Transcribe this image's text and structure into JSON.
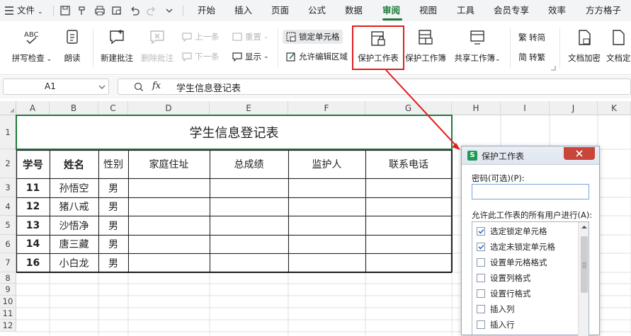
{
  "menubar": {
    "file_label": "文件",
    "tabs": [
      "开始",
      "插入",
      "页面",
      "公式",
      "数据",
      "审阅",
      "视图",
      "工具",
      "会员专享",
      "效率",
      "方方格子"
    ]
  },
  "ribbon": {
    "spellcheck": "拼写检查",
    "read_aloud": "朗读",
    "new_comment": "新建批注",
    "delete_comment": "删除批注",
    "prev_comment": "上一条",
    "next_comment": "下一条",
    "reset": "重置",
    "show": "显示",
    "lock_cell": "锁定单元格",
    "allow_edit_range": "允许编辑区域",
    "protect_sheet": "保护工作表",
    "protect_workbook": "保护工作簿",
    "share_workbook": "共享工作簿",
    "to_simplified": "转简",
    "to_traditional": "转繁",
    "doc_encrypt": "文档加密",
    "doc_final": "文档定"
  },
  "formula_bar": {
    "cell_ref": "A1",
    "fx": "fx",
    "content": "学生信息登记表"
  },
  "sheet": {
    "columns": [
      "A",
      "B",
      "C",
      "D",
      "E",
      "F",
      "G",
      "H",
      "I",
      "J",
      "K"
    ],
    "rows": [
      "1",
      "2",
      "3",
      "4",
      "5",
      "6",
      "7",
      "8",
      "9",
      "10",
      "11",
      "12"
    ],
    "title": "学生信息登记表",
    "headers": [
      "学号",
      "姓名",
      "性别",
      "家庭住址",
      "总成绩",
      "监护人",
      "联系电话"
    ],
    "data": [
      [
        "11",
        "孙悟空",
        "男"
      ],
      [
        "12",
        "猪八戒",
        "男"
      ],
      [
        "13",
        "沙悟净",
        "男"
      ],
      [
        "14",
        "唐三藏",
        "男"
      ],
      [
        "16",
        "小白龙",
        "男"
      ]
    ]
  },
  "dialog": {
    "app_badge": "S",
    "title": "保护工作表",
    "password_label": "密码(可选)(P):",
    "password_value": "",
    "allow_label": "允许此工作表的所有用户进行(A):",
    "options": [
      {
        "label": "选定锁定单元格",
        "checked": true
      },
      {
        "label": "选定未锁定单元格",
        "checked": true
      },
      {
        "label": "设置单元格格式",
        "checked": false
      },
      {
        "label": "设置列格式",
        "checked": false
      },
      {
        "label": "设置行格式",
        "checked": false
      },
      {
        "label": "插入列",
        "checked": false
      },
      {
        "label": "插入行",
        "checked": false
      }
    ]
  },
  "colors": {
    "accent_green": "#1e7a3c",
    "highlight_red": "#e01e1e",
    "check_blue": "#2f6fcf",
    "dialog_close": "#c8453a"
  }
}
